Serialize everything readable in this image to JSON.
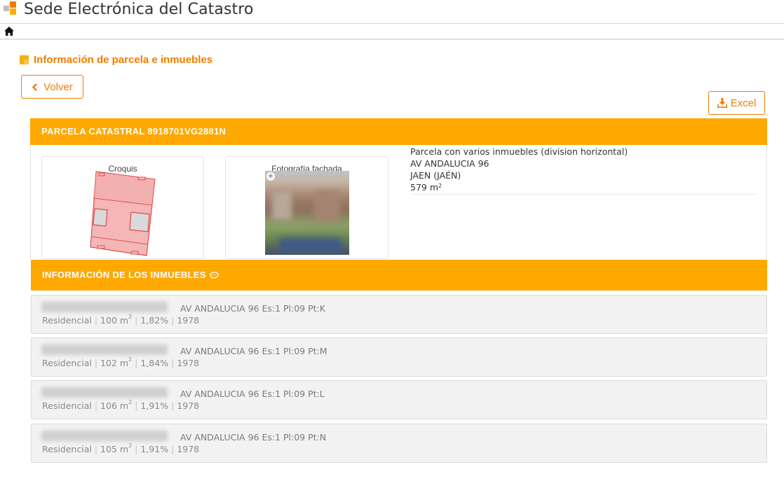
{
  "header": {
    "site_title": "Sede Electrónica del Catastro"
  },
  "section": {
    "title": "Información de parcela e inmuebles",
    "back_label": "Volver",
    "excel_label": "Excel"
  },
  "parcela": {
    "heading": "PARCELA CATASTRAL 8918701VG2881N",
    "croquis_caption": "Croquis",
    "foto_caption": "Fotografía fachada",
    "description": "Parcela con varios inmuebles (division horizontal)",
    "address": "AV ANDALUCIA 96",
    "city": "JAEN (JAÉN)",
    "area": "579 m",
    "area_unit_sup": "2"
  },
  "inmuebles": {
    "heading": "INFORMACIÓN DE LOS INMUEBLES",
    "separator": "|",
    "items": [
      {
        "address": "AV ANDALUCIA 96 Es:1 Pl:09 Pt:K",
        "use": "Residencial",
        "area": "100 m",
        "area_sup": "2",
        "share": "1,82%",
        "year": "1978"
      },
      {
        "address": "AV ANDALUCIA 96 Es:1 Pl:09 Pt:M",
        "use": "Residencial",
        "area": "102 m",
        "area_sup": "2",
        "share": "1,84%",
        "year": "1978"
      },
      {
        "address": "AV ANDALUCIA 96 Es:1 Pl:09 Pt:L",
        "use": "Residencial",
        "area": "106 m",
        "area_sup": "2",
        "share": "1,91%",
        "year": "1978"
      },
      {
        "address": "AV ANDALUCIA 96 Es:1 Pl:09 Pt:N",
        "use": "Residencial",
        "area": "105 m",
        "area_sup": "2",
        "share": "1,91%",
        "year": "1978"
      }
    ]
  },
  "colors": {
    "accent": "#f07d00",
    "panel_header": "#ffa800"
  },
  "icons": {
    "home": "home-icon",
    "back": "chevron-left-icon",
    "excel": "download-icon",
    "chat": "comment-icon",
    "zoom": "zoom-in-icon"
  }
}
